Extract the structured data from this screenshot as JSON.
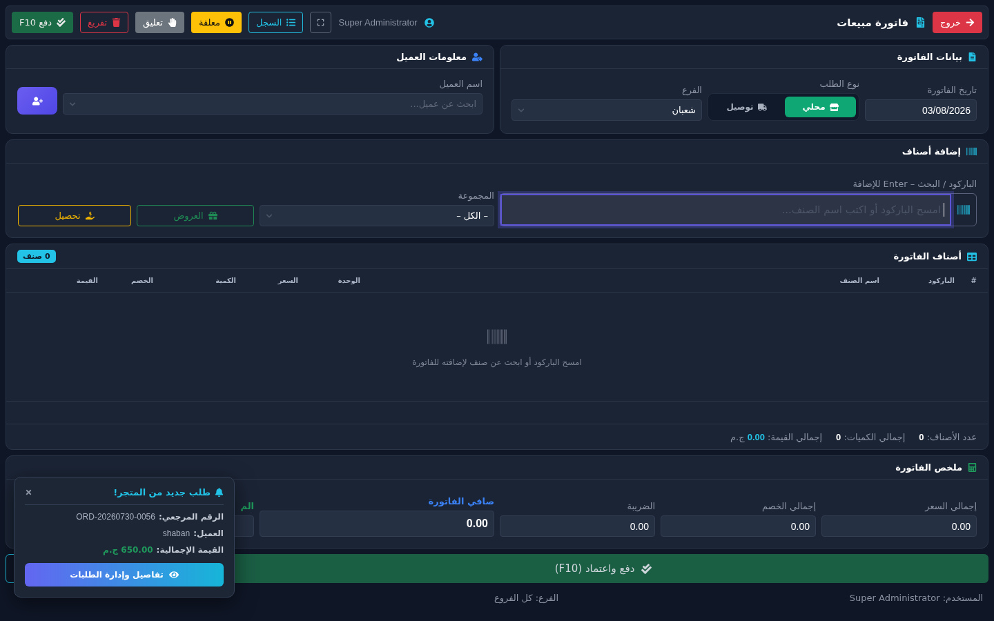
{
  "header": {
    "exit_button": "خروج",
    "title": "فاتورة مبيعات",
    "user": "Super Administrator",
    "buttons": [
      {
        "label": "السجل",
        "kind": "outline-info"
      },
      {
        "label": "معلقة",
        "kind": "warning"
      },
      {
        "label": "تعليق",
        "kind": "secondary"
      },
      {
        "label": "تفريغ",
        "kind": "outline-danger"
      },
      {
        "label": "دفع F10",
        "kind": "success"
      }
    ]
  },
  "invoice_data": {
    "title": "بيانات الفاتورة",
    "date_label": "تاريخ الفاتورة",
    "date": "03/08/2026",
    "order_type_label": "نوع الطلب",
    "order_types": [
      {
        "label": "محلي",
        "kind": "store",
        "selected": true
      },
      {
        "label": "توصيل",
        "kind": "truck",
        "selected": false
      }
    ],
    "branch_label": "الفرع",
    "branch": "شعبان"
  },
  "customer": {
    "title": "معلومات العميل",
    "label": "اسم العميل",
    "placeholder": "ابحث عن عميل..."
  },
  "add_items": {
    "title": "إضافة أصناف",
    "barcode_label": "الباركود / البحث – Enter للإضافة",
    "barcode_placeholder": "امسح الباركود أو اكتب اسم الصنف...",
    "group_label": "المجموعة",
    "group": "– الكل –",
    "offers_button": "العروض",
    "collect_button": "تحصيل"
  },
  "items_table": {
    "title": "أصناف الفاتورة",
    "badge": "0 صنف",
    "columns": [
      "#",
      "الباركود",
      "اسم الصنف",
      "الوحدة",
      "السعر",
      "الكمية",
      "الخصم",
      "القيمة"
    ],
    "empty_text": "امسح الباركود أو ابحث عن صنف لإضافته للفاتورة",
    "stats": [
      {
        "text": "عدد الأصناف: **0**",
        "kind": "plain"
      },
      {
        "text": "إجمالي الكميات: **0**",
        "kind": "plain"
      },
      {
        "text": "إجمالي القيمة: **0.00** ج.م",
        "kind": "accent"
      }
    ]
  },
  "summary": {
    "title": "ملخص الفاتورة",
    "fields": [
      {
        "label": "إجمالي السعر",
        "value": "0.00",
        "kind": "plain"
      },
      {
        "label": "إجمالي الخصم",
        "value": "0.00",
        "kind": "plain"
      },
      {
        "label": "الضريبة",
        "value": "0.00",
        "kind": "plain"
      },
      {
        "label": "صافي الفاتورة",
        "value": "0.00",
        "kind": "net"
      },
      {
        "label": "الم",
        "kind": "partial"
      }
    ]
  },
  "pay_button": "دفع واعتماد (F10)",
  "footer": {
    "user": "المستخدم: Super Administrator",
    "branch": "الفرع: كل الفروع"
  },
  "notification": {
    "title": "طلب جديد من المتجر!",
    "rows": [
      {
        "label": "الرقم المرجعي:",
        "value": "ORD-20260730-0056",
        "kind": "plain"
      },
      {
        "label": "العميل:",
        "value": "shaban",
        "kind": "plain"
      },
      {
        "label": "القيمة الإجمالية:",
        "value": "650.00 ج.م",
        "kind": "money"
      }
    ],
    "button": "تفاصيل وإدارة الطلبات"
  }
}
